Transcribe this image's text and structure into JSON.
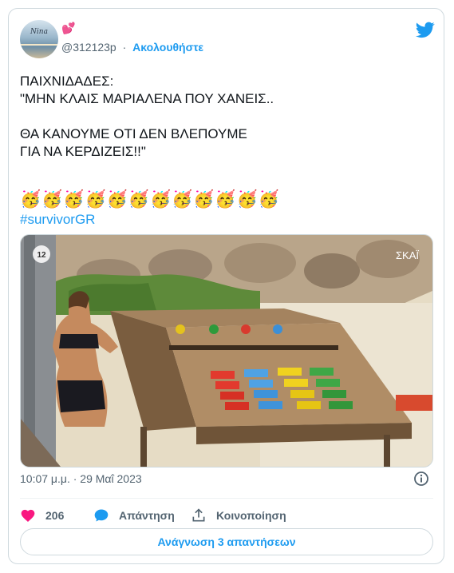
{
  "user": {
    "avatar_text": "Nina",
    "name_emoji": "💕",
    "handle": "@312123p",
    "separator": "·",
    "follow_label": "Ακολουθήστε"
  },
  "tweet": {
    "lines": [
      "ΠΑΙΧΝΙΔΑΔΕΣ:",
      "\"ΜΗΝ ΚΛΑΙΣ ΜΑΡΙΑΛΕΝΑ ΠΟΥ ΧΑΝΕΙΣ..",
      "ΘΑ ΚΑΝΟΥΜΕ ΟΤΙ ΔΕΝ ΒΛΕΠΟΥΜΕ",
      "ΓΙΑ ΝΑ ΚΕΡΔΙΖΕΙΣ!!\""
    ],
    "emojis": [
      "🥳",
      "🥳",
      "🥳",
      "🥳",
      "🥳",
      "🥳",
      "🥳",
      "🥳",
      "🥳",
      "🥳",
      "🥳",
      "🥳"
    ],
    "hashtag": "#survivorGR"
  },
  "media": {
    "channel_badge": "12",
    "network_logo": "ΣΚΑΪ"
  },
  "meta": {
    "timestamp": "10:07 μ.μ. · 29 Μαΐ 2023"
  },
  "actions": {
    "like_count": "206",
    "reply_label": "Απάντηση",
    "share_label": "Κοινοποίηση"
  },
  "footer": {
    "read_replies_label": "Ανάγνωση 3 απαντήσεων"
  },
  "colors": {
    "accent": "#1d9bf0",
    "like": "#f91880",
    "muted": "#536471"
  }
}
